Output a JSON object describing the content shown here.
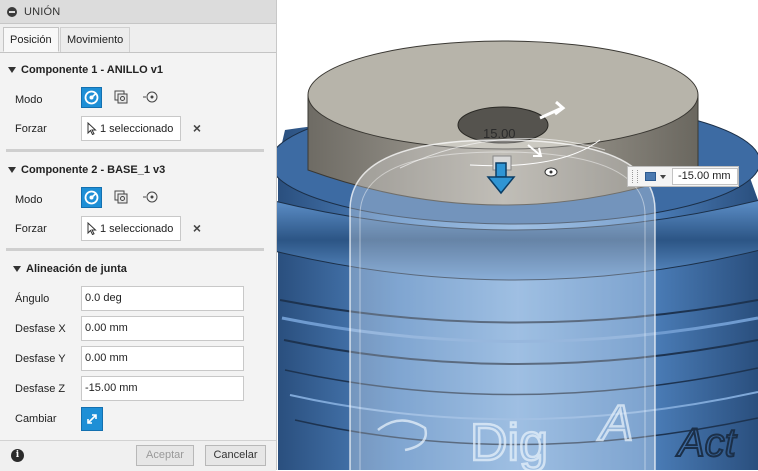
{
  "dialog": {
    "title": "UNIÓN",
    "tabs": [
      {
        "label": "Posición",
        "active": true
      },
      {
        "label": "Movimiento",
        "active": false
      }
    ],
    "component1": {
      "header": "Componente 1 - ANILLO v1",
      "mode_label": "Modo",
      "force_label": "Forzar",
      "selection": "1 seleccionado"
    },
    "component2": {
      "header": "Componente 2 - BASE_1 v3",
      "mode_label": "Modo",
      "force_label": "Forzar",
      "selection": "1 seleccionado"
    },
    "alignment": {
      "header": "Alineación de junta",
      "angle_label": "Ángulo",
      "angle_value": "0.0 deg",
      "offset_x_label": "Desfase X",
      "offset_x_value": "0.00 mm",
      "offset_y_label": "Desfase Y",
      "offset_y_value": "0.00 mm",
      "offset_z_label": "Desfase Z",
      "offset_z_value": "-15.00 mm",
      "flip_label": "Cambiar"
    },
    "footer": {
      "ok_label": "Aceptar",
      "cancel_label": "Cancelar"
    }
  },
  "viewport": {
    "dimension_text": "15.00",
    "float_value": "-15.00 mm",
    "engraving_text_1": "Dig",
    "engraving_text_2": "Act",
    "engraving_text_3": "A"
  },
  "colors": {
    "accent": "#1e8fd6",
    "model_blue": "#3f6fa8",
    "ring_gray": "#8a877f"
  }
}
